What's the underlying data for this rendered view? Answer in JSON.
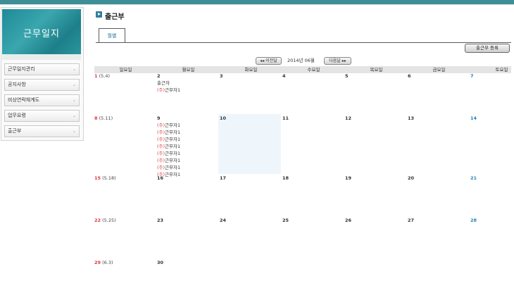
{
  "sidebar": {
    "header": "근무일지",
    "items": [
      {
        "label": "근무일지관리"
      },
      {
        "label": "공지사항"
      },
      {
        "label": "비상연락체계도"
      },
      {
        "label": "업무요령"
      },
      {
        "label": "출근부"
      }
    ]
  },
  "main": {
    "title": "출근부",
    "tab_label": "월별",
    "register_button": "출근부 등록",
    "prev_button": "◂◂ 이전달",
    "next_button": "다음달 ▸▸",
    "month_label": "2014년 06월"
  },
  "calendar": {
    "weekdays": [
      "일요일",
      "월요일",
      "화요일",
      "수요일",
      "목요일",
      "금요일",
      "토요일"
    ],
    "weeks": [
      {
        "days": [
          {
            "num": "1",
            "lunar": "(5.4)",
            "events": []
          },
          {
            "num": "2",
            "lunar": "",
            "events": [
              {
                "tag": "",
                "text": "출근자"
              },
              {
                "tag": "(주)",
                "text": "근무자1"
              }
            ]
          },
          {
            "num": "3",
            "lunar": "",
            "events": []
          },
          {
            "num": "4",
            "lunar": "",
            "events": []
          },
          {
            "num": "5",
            "lunar": "",
            "events": []
          },
          {
            "num": "6",
            "lunar": "",
            "events": []
          },
          {
            "num": "7",
            "lunar": "",
            "events": []
          }
        ]
      },
      {
        "days": [
          {
            "num": "8",
            "lunar": "(5.11)",
            "events": []
          },
          {
            "num": "9",
            "lunar": "",
            "events": [
              {
                "tag": "(주)",
                "text": "근무자1"
              },
              {
                "tag": "(주)",
                "text": "근무자1"
              },
              {
                "tag": "(주)",
                "text": "근무자1"
              },
              {
                "tag": "(주)",
                "text": "근무자1"
              },
              {
                "tag": "(주)",
                "text": "근무자1"
              },
              {
                "tag": "(주)",
                "text": "근무자1"
              },
              {
                "tag": "(주)",
                "text": "근무자1"
              },
              {
                "tag": "(주)",
                "text": "근무자1"
              }
            ]
          },
          {
            "num": "10",
            "lunar": "",
            "events": []
          },
          {
            "num": "11",
            "lunar": "",
            "events": []
          },
          {
            "num": "12",
            "lunar": "",
            "events": []
          },
          {
            "num": "13",
            "lunar": "",
            "events": []
          },
          {
            "num": "14",
            "lunar": "",
            "events": []
          }
        ]
      },
      {
        "days": [
          {
            "num": "15",
            "lunar": "(5.18)",
            "events": []
          },
          {
            "num": "16",
            "lunar": "",
            "events": []
          },
          {
            "num": "17",
            "lunar": "",
            "events": []
          },
          {
            "num": "18",
            "lunar": "",
            "events": []
          },
          {
            "num": "19",
            "lunar": "",
            "events": []
          },
          {
            "num": "20",
            "lunar": "",
            "events": []
          },
          {
            "num": "21",
            "lunar": "",
            "events": []
          }
        ]
      },
      {
        "days": [
          {
            "num": "22",
            "lunar": "(5.25)",
            "events": []
          },
          {
            "num": "23",
            "lunar": "",
            "events": []
          },
          {
            "num": "24",
            "lunar": "",
            "events": []
          },
          {
            "num": "25",
            "lunar": "",
            "events": []
          },
          {
            "num": "26",
            "lunar": "",
            "events": []
          },
          {
            "num": "27",
            "lunar": "",
            "events": []
          },
          {
            "num": "28",
            "lunar": "",
            "events": []
          }
        ]
      },
      {
        "days": [
          {
            "num": "29",
            "lunar": "(6.3)",
            "events": []
          },
          {
            "num": "30",
            "lunar": "",
            "events": []
          }
        ]
      }
    ]
  },
  "colors": {
    "accent": "#3e8e96",
    "sunday": "#e03b3b",
    "saturday": "#2a7fb8",
    "today_bg": "#eef6fc"
  }
}
